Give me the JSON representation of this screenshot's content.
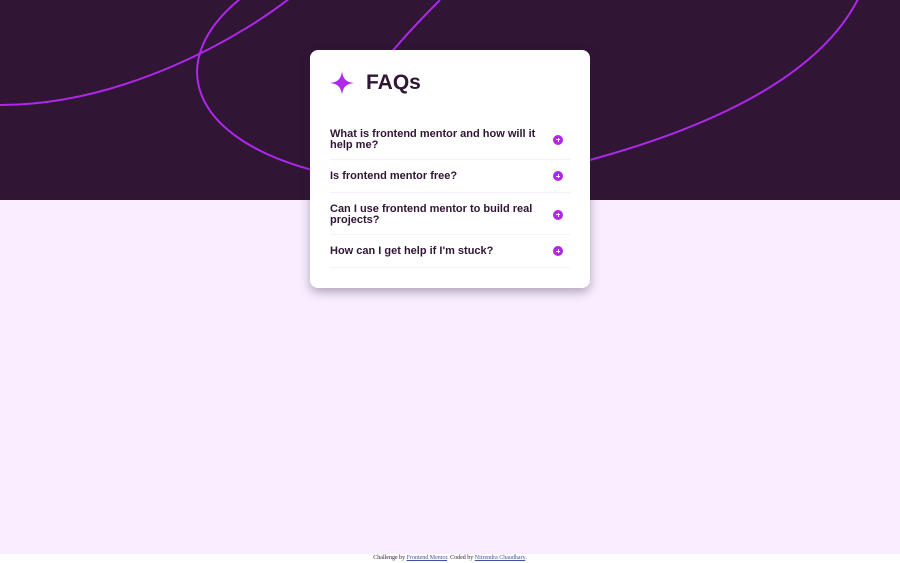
{
  "colors": {
    "hero_background": "#301534",
    "page_background": "#f8eeff",
    "accent": "#ad28eb",
    "heading": "#301534",
    "link": "#3e52a3"
  },
  "faq": {
    "icon": "star-icon",
    "title": "FAQs",
    "items": [
      {
        "question": "What is frontend mentor and how will it help me?",
        "icon": "plus-icon"
      },
      {
        "question": "Is frontend mentor free?",
        "icon": "plus-icon"
      },
      {
        "question": "Can I use frontend mentor to build real projects?",
        "icon": "plus-icon"
      },
      {
        "question": "How can I get help if I'm stuck?",
        "icon": "plus-icon"
      }
    ]
  },
  "attribution": {
    "prefix": "Challenge by ",
    "challenge_link": "Frontend Mentor",
    "middle": ". Coded by ",
    "author_link": "Nitrendra Chaudhary",
    "suffix": "."
  }
}
